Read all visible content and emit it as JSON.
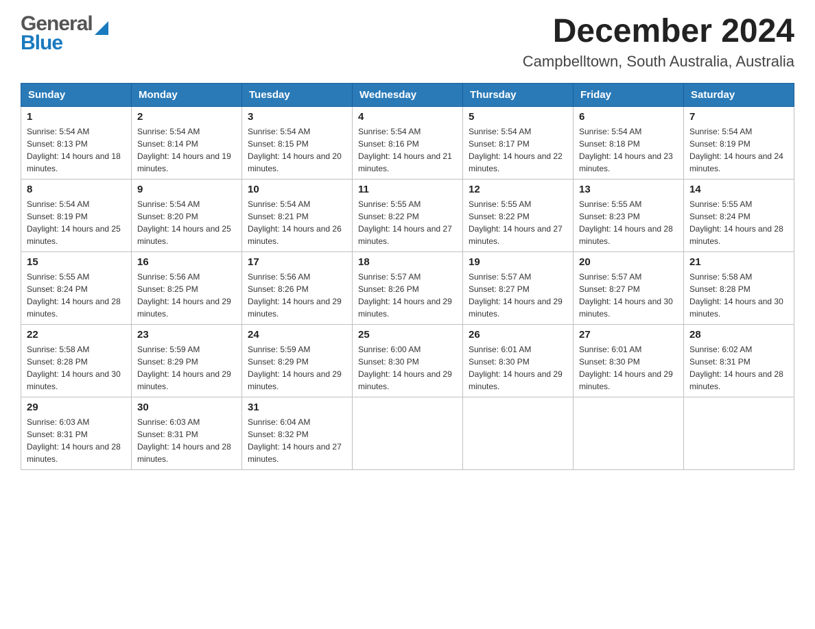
{
  "header": {
    "logo_general": "General",
    "logo_blue": "Blue",
    "title": "December 2024",
    "subtitle": "Campbelltown, South Australia, Australia"
  },
  "days_of_week": [
    "Sunday",
    "Monday",
    "Tuesday",
    "Wednesday",
    "Thursday",
    "Friday",
    "Saturday"
  ],
  "weeks": [
    [
      {
        "day": "1",
        "sunrise": "5:54 AM",
        "sunset": "8:13 PM",
        "daylight": "14 hours and 18 minutes."
      },
      {
        "day": "2",
        "sunrise": "5:54 AM",
        "sunset": "8:14 PM",
        "daylight": "14 hours and 19 minutes."
      },
      {
        "day": "3",
        "sunrise": "5:54 AM",
        "sunset": "8:15 PM",
        "daylight": "14 hours and 20 minutes."
      },
      {
        "day": "4",
        "sunrise": "5:54 AM",
        "sunset": "8:16 PM",
        "daylight": "14 hours and 21 minutes."
      },
      {
        "day": "5",
        "sunrise": "5:54 AM",
        "sunset": "8:17 PM",
        "daylight": "14 hours and 22 minutes."
      },
      {
        "day": "6",
        "sunrise": "5:54 AM",
        "sunset": "8:18 PM",
        "daylight": "14 hours and 23 minutes."
      },
      {
        "day": "7",
        "sunrise": "5:54 AM",
        "sunset": "8:19 PM",
        "daylight": "14 hours and 24 minutes."
      }
    ],
    [
      {
        "day": "8",
        "sunrise": "5:54 AM",
        "sunset": "8:19 PM",
        "daylight": "14 hours and 25 minutes."
      },
      {
        "day": "9",
        "sunrise": "5:54 AM",
        "sunset": "8:20 PM",
        "daylight": "14 hours and 25 minutes."
      },
      {
        "day": "10",
        "sunrise": "5:54 AM",
        "sunset": "8:21 PM",
        "daylight": "14 hours and 26 minutes."
      },
      {
        "day": "11",
        "sunrise": "5:55 AM",
        "sunset": "8:22 PM",
        "daylight": "14 hours and 27 minutes."
      },
      {
        "day": "12",
        "sunrise": "5:55 AM",
        "sunset": "8:22 PM",
        "daylight": "14 hours and 27 minutes."
      },
      {
        "day": "13",
        "sunrise": "5:55 AM",
        "sunset": "8:23 PM",
        "daylight": "14 hours and 28 minutes."
      },
      {
        "day": "14",
        "sunrise": "5:55 AM",
        "sunset": "8:24 PM",
        "daylight": "14 hours and 28 minutes."
      }
    ],
    [
      {
        "day": "15",
        "sunrise": "5:55 AM",
        "sunset": "8:24 PM",
        "daylight": "14 hours and 28 minutes."
      },
      {
        "day": "16",
        "sunrise": "5:56 AM",
        "sunset": "8:25 PM",
        "daylight": "14 hours and 29 minutes."
      },
      {
        "day": "17",
        "sunrise": "5:56 AM",
        "sunset": "8:26 PM",
        "daylight": "14 hours and 29 minutes."
      },
      {
        "day": "18",
        "sunrise": "5:57 AM",
        "sunset": "8:26 PM",
        "daylight": "14 hours and 29 minutes."
      },
      {
        "day": "19",
        "sunrise": "5:57 AM",
        "sunset": "8:27 PM",
        "daylight": "14 hours and 29 minutes."
      },
      {
        "day": "20",
        "sunrise": "5:57 AM",
        "sunset": "8:27 PM",
        "daylight": "14 hours and 30 minutes."
      },
      {
        "day": "21",
        "sunrise": "5:58 AM",
        "sunset": "8:28 PM",
        "daylight": "14 hours and 30 minutes."
      }
    ],
    [
      {
        "day": "22",
        "sunrise": "5:58 AM",
        "sunset": "8:28 PM",
        "daylight": "14 hours and 30 minutes."
      },
      {
        "day": "23",
        "sunrise": "5:59 AM",
        "sunset": "8:29 PM",
        "daylight": "14 hours and 29 minutes."
      },
      {
        "day": "24",
        "sunrise": "5:59 AM",
        "sunset": "8:29 PM",
        "daylight": "14 hours and 29 minutes."
      },
      {
        "day": "25",
        "sunrise": "6:00 AM",
        "sunset": "8:30 PM",
        "daylight": "14 hours and 29 minutes."
      },
      {
        "day": "26",
        "sunrise": "6:01 AM",
        "sunset": "8:30 PM",
        "daylight": "14 hours and 29 minutes."
      },
      {
        "day": "27",
        "sunrise": "6:01 AM",
        "sunset": "8:30 PM",
        "daylight": "14 hours and 29 minutes."
      },
      {
        "day": "28",
        "sunrise": "6:02 AM",
        "sunset": "8:31 PM",
        "daylight": "14 hours and 28 minutes."
      }
    ],
    [
      {
        "day": "29",
        "sunrise": "6:03 AM",
        "sunset": "8:31 PM",
        "daylight": "14 hours and 28 minutes."
      },
      {
        "day": "30",
        "sunrise": "6:03 AM",
        "sunset": "8:31 PM",
        "daylight": "14 hours and 28 minutes."
      },
      {
        "day": "31",
        "sunrise": "6:04 AM",
        "sunset": "8:32 PM",
        "daylight": "14 hours and 27 minutes."
      },
      null,
      null,
      null,
      null
    ]
  ]
}
